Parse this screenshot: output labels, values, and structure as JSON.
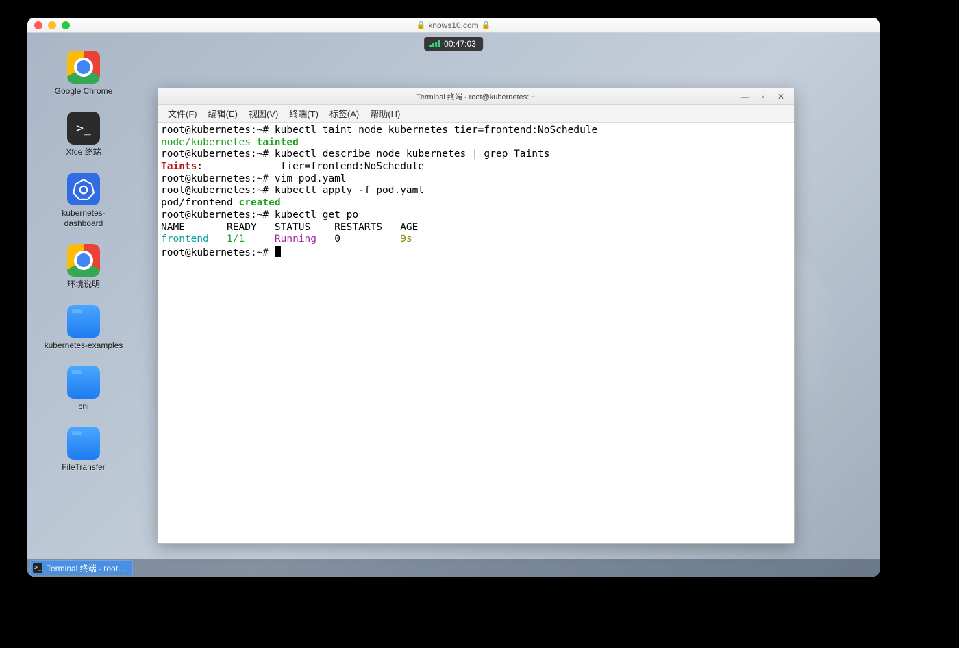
{
  "browser": {
    "url": "knows10.com"
  },
  "recorder": {
    "time": "00:47:03"
  },
  "desktop": {
    "chrome": "Google Chrome",
    "xfce_term": "Xfce 终端",
    "k8s_dash": "kubernetes-dashboard",
    "env": "环境说明",
    "k8s_ex": "kubernetes-examples",
    "cni": "cni",
    "ft": "FileTransfer"
  },
  "terminal": {
    "title": "Terminal 终端 - root@kubernetes: ~",
    "menu": {
      "file": "文件(F)",
      "edit": "编辑(E)",
      "view": "视图(V)",
      "term": "终端(T)",
      "tabs": "标签(A)",
      "help": "帮助(H)"
    },
    "prompt": "root@kubernetes:~#",
    "lines": {
      "cmd1": "kubectl taint node kubernetes tier=frontend:NoSchedule",
      "out1a": "node/kubernetes ",
      "out1b": "tainted",
      "cmd2": "kubectl describe node kubernetes | grep Taints",
      "out2a": "Taints",
      "out2b": ":             tier=frontend:NoSchedule",
      "cmd3": "vim pod.yaml",
      "cmd4": "kubectl apply -f pod.yaml",
      "out4a": "pod/frontend ",
      "out4b": "created",
      "cmd5": "kubectl get po",
      "hdr": "NAME       READY   STATUS    RESTARTS   AGE",
      "row_name": "frontend",
      "row_ready": "1/1",
      "row_status": "Running",
      "row_restarts": "0",
      "row_age": "9s"
    }
  },
  "taskbar": {
    "label": "Terminal 终端 - root…"
  }
}
